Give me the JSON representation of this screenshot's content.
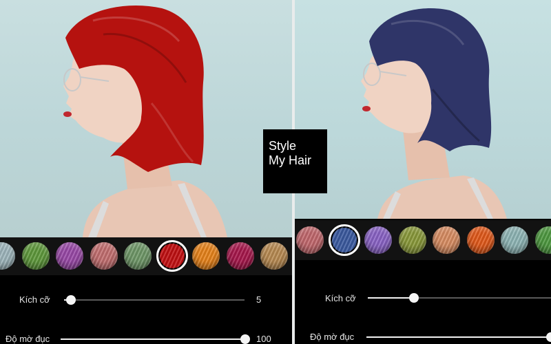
{
  "logo": {
    "line1": "Style",
    "line2": "My Hair"
  },
  "left_panel": {
    "hair_color": "#b5120f",
    "swatches": [
      {
        "name": "light-blue",
        "color": "#9fb7bd"
      },
      {
        "name": "green",
        "color": "#5f9a3c"
      },
      {
        "name": "purple",
        "color": "#9a49a8"
      },
      {
        "name": "rose",
        "color": "#c46f70"
      },
      {
        "name": "sage",
        "color": "#6f9868"
      },
      {
        "name": "red",
        "color": "#c20f12",
        "selected": true
      },
      {
        "name": "orange",
        "color": "#e8831a"
      },
      {
        "name": "crimson",
        "color": "#a8174c"
      },
      {
        "name": "gold",
        "color": "#b98b52"
      }
    ],
    "sliders": [
      {
        "label": "Kích cỡ",
        "value": "5",
        "level": 0.04
      },
      {
        "label": "Độ mờ đục",
        "value": "100",
        "level": 1.0
      }
    ]
  },
  "right_panel": {
    "hair_color": "#2f3568",
    "swatches": [
      {
        "name": "rose",
        "color": "#c2686d"
      },
      {
        "name": "navy",
        "color": "#3b5aa0",
        "selected": true
      },
      {
        "name": "violet",
        "color": "#8a63c6"
      },
      {
        "name": "olive",
        "color": "#8a9a3a"
      },
      {
        "name": "peach",
        "color": "#d98d62"
      },
      {
        "name": "orange-red",
        "color": "#e2591a"
      },
      {
        "name": "light-teal",
        "color": "#8fb6b6"
      },
      {
        "name": "green",
        "color": "#4e9a40"
      }
    ],
    "sliders": [
      {
        "label": "Kích cỡ",
        "value": "",
        "level": 0.25
      },
      {
        "label": "Độ mờ đục",
        "value": "",
        "level": 1.0
      }
    ]
  }
}
